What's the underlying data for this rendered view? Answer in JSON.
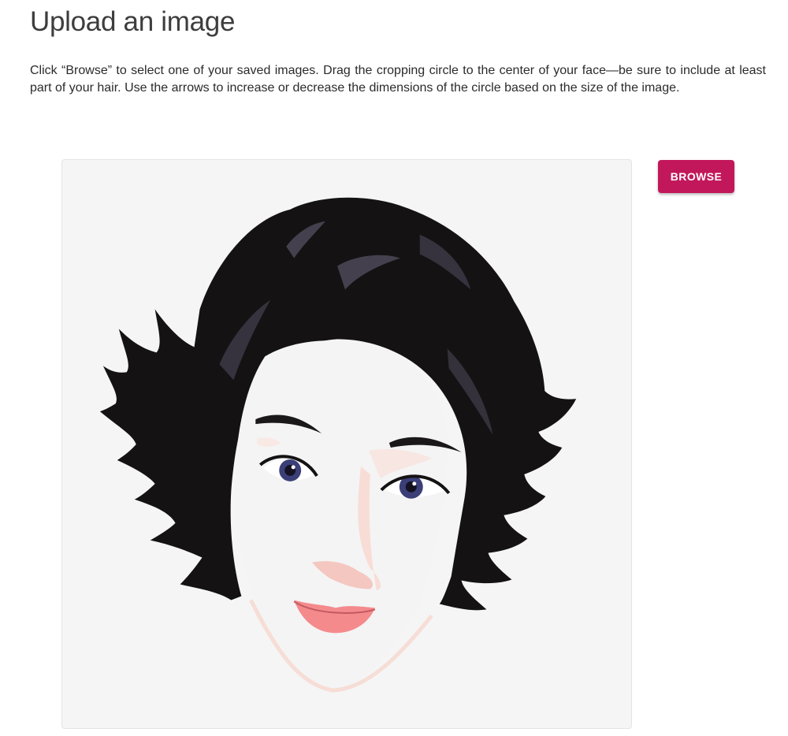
{
  "page": {
    "title": "Upload an image",
    "instructions": "Click “Browse” to select one of your saved images. Drag the cropping circle to the center of your face—be sure to include at least part of your hair. Use the arrows to increase or decrease the dimensions of the circle based on the size of the image."
  },
  "uploader": {
    "browse_label": "BROWSE",
    "preview_image": "illustrated-portrait-woman-short-black-hair"
  },
  "colors": {
    "accent": "#c2185b",
    "panel_background": "#f5f5f5",
    "hair": "#141213",
    "lips": "#f48a8c",
    "iris": "#3b3f78"
  }
}
